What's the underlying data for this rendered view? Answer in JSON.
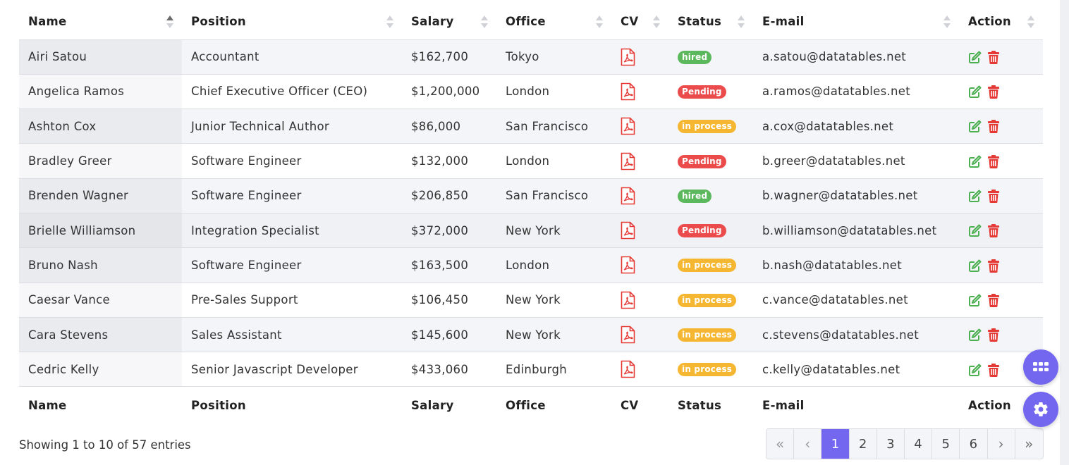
{
  "table": {
    "columns": [
      "Name",
      "Position",
      "Salary",
      "Office",
      "CV",
      "Status",
      "E-mail",
      "Action"
    ],
    "rows": [
      {
        "name": "Airi Satou",
        "position": "Accountant",
        "salary": "$162,700",
        "office": "Tokyo",
        "status": "hired",
        "email": "a.satou@datatables.net"
      },
      {
        "name": "Angelica Ramos",
        "position": "Chief Executive Officer (CEO)",
        "salary": "$1,200,000",
        "office": "London",
        "status": "Pending",
        "email": "a.ramos@datatables.net"
      },
      {
        "name": "Ashton Cox",
        "position": "Junior Technical Author",
        "salary": "$86,000",
        "office": "San Francisco",
        "status": "in process",
        "email": "a.cox@datatables.net"
      },
      {
        "name": "Bradley Greer",
        "position": "Software Engineer",
        "salary": "$132,000",
        "office": "London",
        "status": "Pending",
        "email": "b.greer@datatables.net"
      },
      {
        "name": "Brenden Wagner",
        "position": "Software Engineer",
        "salary": "$206,850",
        "office": "San Francisco",
        "status": "hired",
        "email": "b.wagner@datatables.net"
      },
      {
        "name": "Brielle Williamson",
        "position": "Integration Specialist",
        "salary": "$372,000",
        "office": "New York",
        "status": "Pending",
        "email": "b.williamson@datatables.net"
      },
      {
        "name": "Bruno Nash",
        "position": "Software Engineer",
        "salary": "$163,500",
        "office": "London",
        "status": "in process",
        "email": "b.nash@datatables.net"
      },
      {
        "name": "Caesar Vance",
        "position": "Pre-Sales Support",
        "salary": "$106,450",
        "office": "New York",
        "status": "in process",
        "email": "c.vance@datatables.net"
      },
      {
        "name": "Cara Stevens",
        "position": "Sales Assistant",
        "salary": "$145,600",
        "office": "New York",
        "status": "in process",
        "email": "c.stevens@datatables.net"
      },
      {
        "name": "Cedric Kelly",
        "position": "Senior Javascript Developer",
        "salary": "$433,060",
        "office": "Edinburgh",
        "status": "in process",
        "email": "c.kelly@datatables.net"
      }
    ]
  },
  "info": "Showing 1 to 10 of 57 entries",
  "pagination": {
    "first": "«",
    "prev": "‹",
    "pages": [
      "1",
      "2",
      "3",
      "4",
      "5",
      "6"
    ],
    "active": "1",
    "next": "›",
    "last": "»"
  },
  "icons": {
    "cv": "pdf-file-icon",
    "edit": "edit-icon",
    "delete": "trash-icon",
    "apps": "grid-icon",
    "settings": "gear-icon"
  },
  "colors": {
    "accent": "#7367f0",
    "hired": "#5cb85c",
    "pending": "#ec4b4b",
    "in_process": "#f5b731",
    "pdf": "#e53935",
    "edit": "#4caf50",
    "delete": "#e53935"
  }
}
